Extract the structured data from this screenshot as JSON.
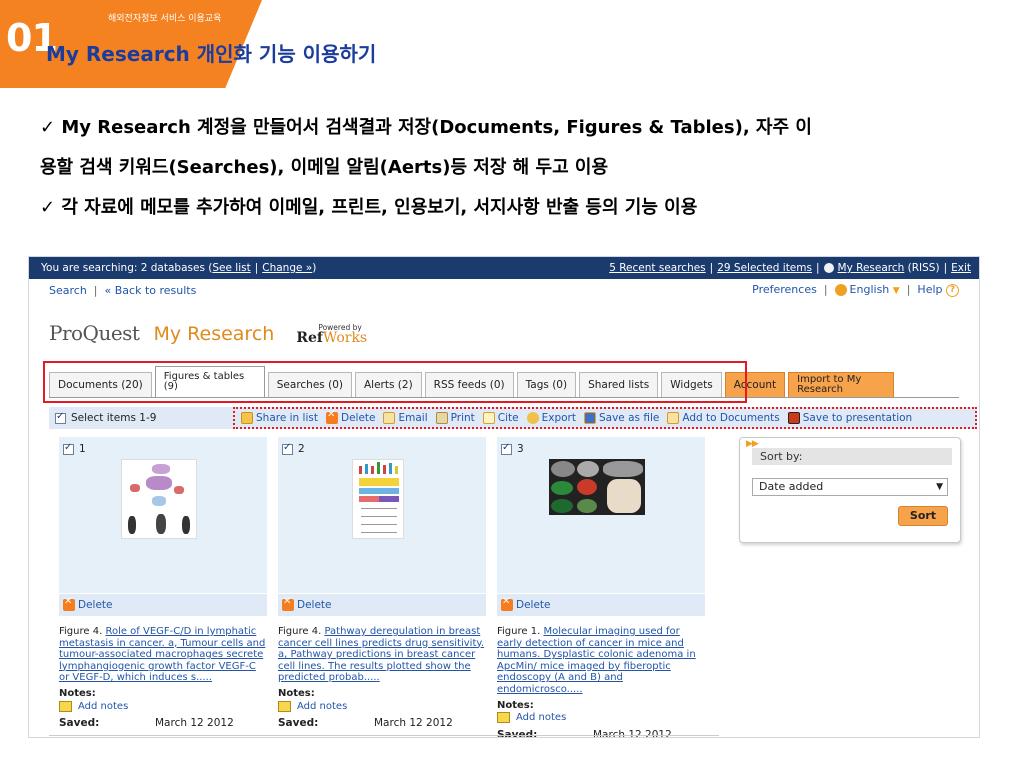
{
  "slide": {
    "badge_number": "01",
    "subtitle": "해외전자정보 서비스 이용교육",
    "title": "My Research 개인화 기능 이용하기",
    "bullets": [
      "✓ My Research 계정을 만들어서 검색결과 저장(Documents, Figures & Tables), 자주 이",
      "용할 검색 키워드(Searches), 이메일 알림(Aerts)등 저장 해 두고 이용",
      "✓ 각 자료에 메모를 추가하여 이메일, 프린트, 인용보기, 서지사항 반출 등의 기능 이용"
    ]
  },
  "topbar": {
    "searching_prefix": "You are searching: 2 databases (",
    "see_list": "See list",
    "change": "Change »",
    "searching_suffix": ")",
    "recent_searches": "5 Recent searches",
    "selected_items": "29 Selected items",
    "my_research": "My Research",
    "riss": "(RISS)",
    "exit": "Exit"
  },
  "nav": {
    "search": "Search",
    "back": "« Back to results",
    "preferences": "Preferences",
    "language": "English",
    "help": "Help"
  },
  "brand": {
    "proquest": "ProQuest",
    "my_research": "My Research",
    "powered_by": "Powered by",
    "ref": "Ref",
    "works": "Works"
  },
  "tabs": [
    {
      "label": "Documents (20)"
    },
    {
      "label": "Figures & tables (9)"
    },
    {
      "label": "Searches (0)"
    },
    {
      "label": "Alerts (2)"
    },
    {
      "label": "RSS feeds (0)"
    },
    {
      "label": "Tags (0)"
    },
    {
      "label": "Shared lists"
    },
    {
      "label": "Widgets"
    },
    {
      "label": "Account"
    },
    {
      "label": "Import to My Research"
    }
  ],
  "actionbar": {
    "select_items": "Select items 1-9",
    "actions": [
      {
        "label": "Share in list",
        "icon": "share-icon"
      },
      {
        "label": "Delete",
        "icon": "delete-icon"
      },
      {
        "label": "Email",
        "icon": "email-icon"
      },
      {
        "label": "Print",
        "icon": "print-icon"
      },
      {
        "label": "Cite",
        "icon": "cite-icon"
      },
      {
        "label": "Export",
        "icon": "export-icon"
      },
      {
        "label": "Save as file",
        "icon": "save-file-icon"
      },
      {
        "label": "Add to Documents",
        "icon": "add-documents-icon"
      },
      {
        "label": "Save to presentation",
        "icon": "presentation-icon"
      }
    ]
  },
  "cards": [
    {
      "number": "1",
      "delete": "Delete",
      "caption_prefix": "Figure 4.",
      "caption_link": "Role of VEGF-C/D in lymphatic metastasis in cancer. a, Tumour cells and tumour-associated macrophages secrete lymphangiogenic growth factor VEGF-C or VEGF-D, which induces s.....",
      "notes_label": "Notes:",
      "add_notes": "Add notes",
      "saved_label": "Saved:",
      "saved_date": "March 12 2012"
    },
    {
      "number": "2",
      "delete": "Delete",
      "caption_prefix": "Figure 4.",
      "caption_link": "Pathway deregulation in breast cancer cell lines predicts drug sensitivity. a, Pathway predictions in breast cancer cell lines. The results plotted show the predicted probab.....",
      "notes_label": "Notes:",
      "add_notes": "Add notes",
      "saved_label": "Saved:",
      "saved_date": "March 12 2012"
    },
    {
      "number": "3",
      "delete": "Delete",
      "caption_prefix": "Figure 1.",
      "caption_link": "Molecular imaging used for early detection of cancer in mice and humans. Dysplastic colonic adenoma in ApcMin/ mice imaged by fiberoptic endoscopy (A and B) and endomicrosco.....",
      "notes_label": "Notes:",
      "add_notes": "Add notes",
      "saved_label": "Saved:",
      "saved_date": "March 12 2012"
    }
  ],
  "sort": {
    "label": "Sort by:",
    "selected": "Date added",
    "button": "Sort"
  },
  "colors": {
    "accent_orange": "#f58220",
    "title_blue": "#1a3c9c",
    "topbar_navy": "#1b3b6f",
    "link_blue": "#2255aa",
    "highlight_red": "#e31b23"
  }
}
